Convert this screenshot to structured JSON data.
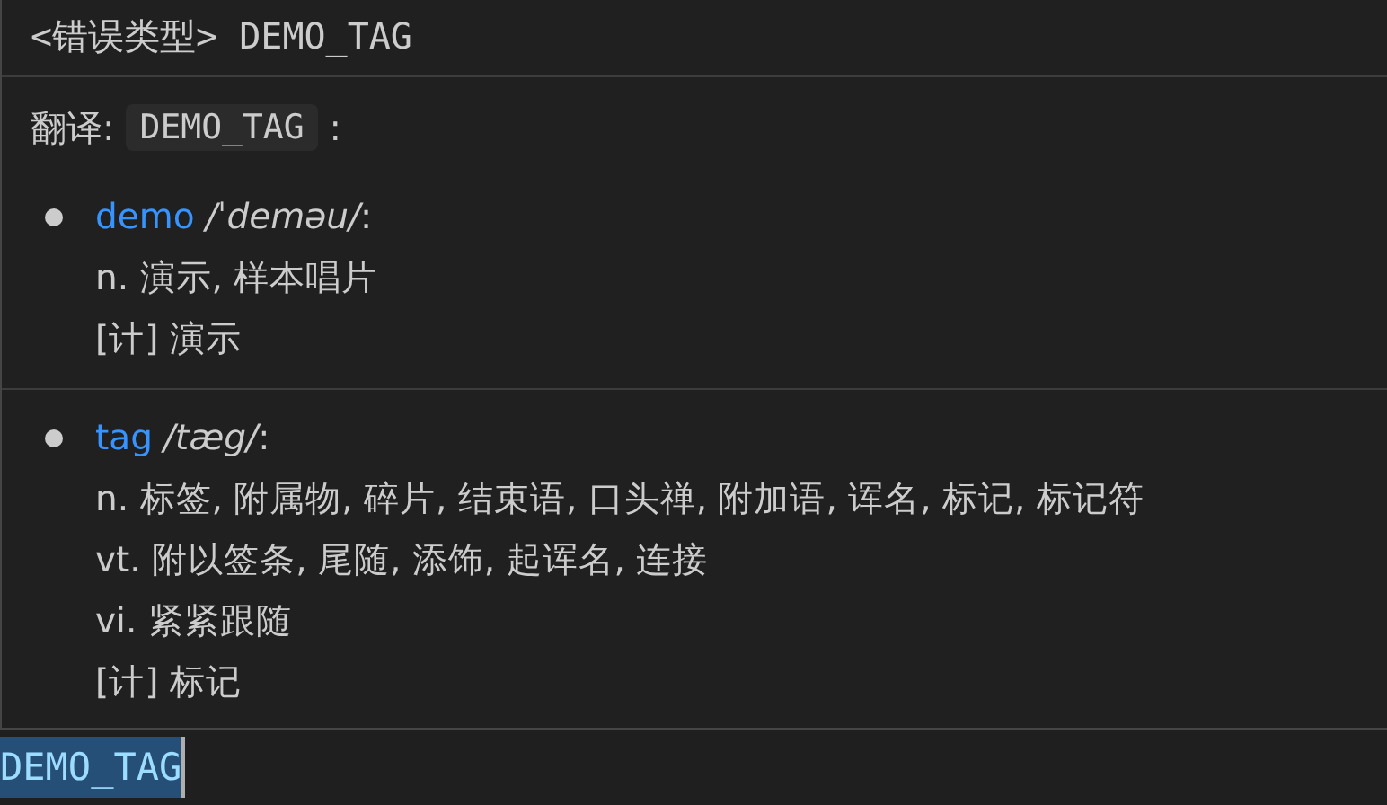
{
  "hover": {
    "title": "<错误类型> DEMO_TAG",
    "translation_label": "翻译:",
    "translation_code": "DEMO_TAG",
    "translation_suffix": ":",
    "entries": [
      {
        "word": "demo",
        "phonetic": "/ˈdeməu/",
        "suffix": ":",
        "lines": [
          "n. 演示, 样本唱片",
          "[计] 演示"
        ]
      },
      {
        "word": "tag",
        "phonetic": "/tæg/",
        "suffix": ":",
        "lines": [
          "n. 标签, 附属物, 碎片, 结束语, 口头禅, 附加语, 诨名, 标记, 标记符",
          "vt. 附以签条, 尾随, 添饰, 起诨名, 连接",
          "vi. 紧紧跟随",
          "[计] 标记"
        ]
      }
    ]
  },
  "editor": {
    "text": "DEMO_TAG",
    "selected": true
  }
}
